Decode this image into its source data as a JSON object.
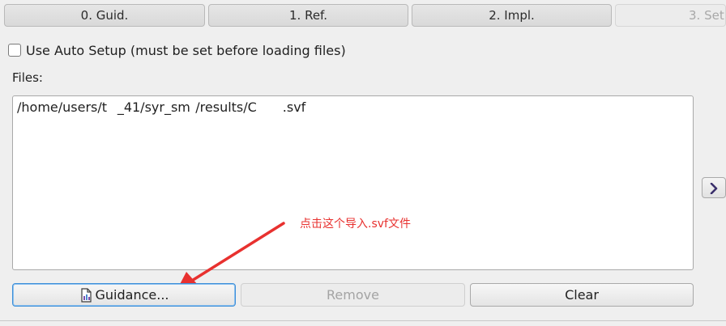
{
  "tabs": [
    {
      "label": "0. Guid."
    },
    {
      "label": "1. Ref."
    },
    {
      "label": "2. Impl."
    },
    {
      "label": "3. Set"
    }
  ],
  "auto_setup": {
    "label": "Use Auto Setup (must be set before loading files)",
    "checked": false
  },
  "files": {
    "label": "Files:",
    "items": [
      "/home/users/t    _41/syr_sm  /results/C          .svf"
    ]
  },
  "annotation": {
    "text": "点击这个导入.svf文件",
    "color": "#e8312f"
  },
  "buttons": {
    "guidance": "Guidance...",
    "remove": "Remove",
    "clear": "Clear"
  },
  "icons": {
    "guidance": "document-chart-icon",
    "side_arrow": "chevron-right-icon"
  },
  "colors": {
    "focus_border": "#3d8fd9"
  }
}
